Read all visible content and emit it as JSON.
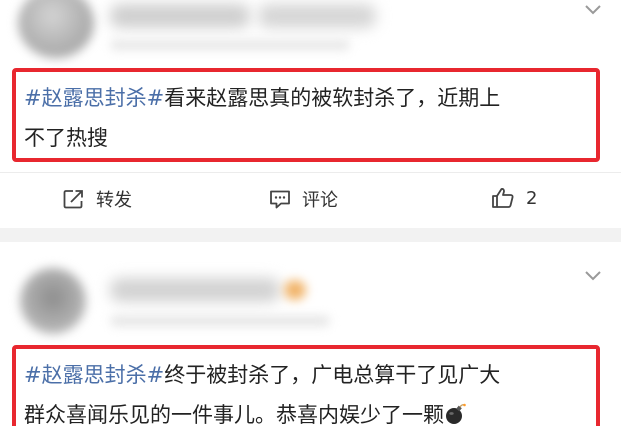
{
  "posts": [
    {
      "hashtag": "#赵露思封杀#",
      "text_line1": "看来赵露思真的被软封杀了，近期上",
      "text_line2": "不了热搜",
      "actions": {
        "repost_label": "转发",
        "comment_label": "评论",
        "like_count": "2"
      }
    },
    {
      "hashtag": "#赵露思封杀#",
      "text_line1": "终于被封杀了，广电总算干了见广大",
      "text_line2": "群众喜闻乐见的一件事儿。恭喜内娱少了一颗"
    }
  ],
  "icons": {
    "more": "chevron-down-icon",
    "repost": "share-box-icon",
    "comment": "comment-bubble-icon",
    "like": "thumbs-up-icon",
    "emoji": "bomb-emoji-icon"
  },
  "colors": {
    "highlight_border": "#e8272f",
    "hashtag": "#4b6fa8",
    "text": "#222222",
    "separator": "#f2f2f2"
  }
}
